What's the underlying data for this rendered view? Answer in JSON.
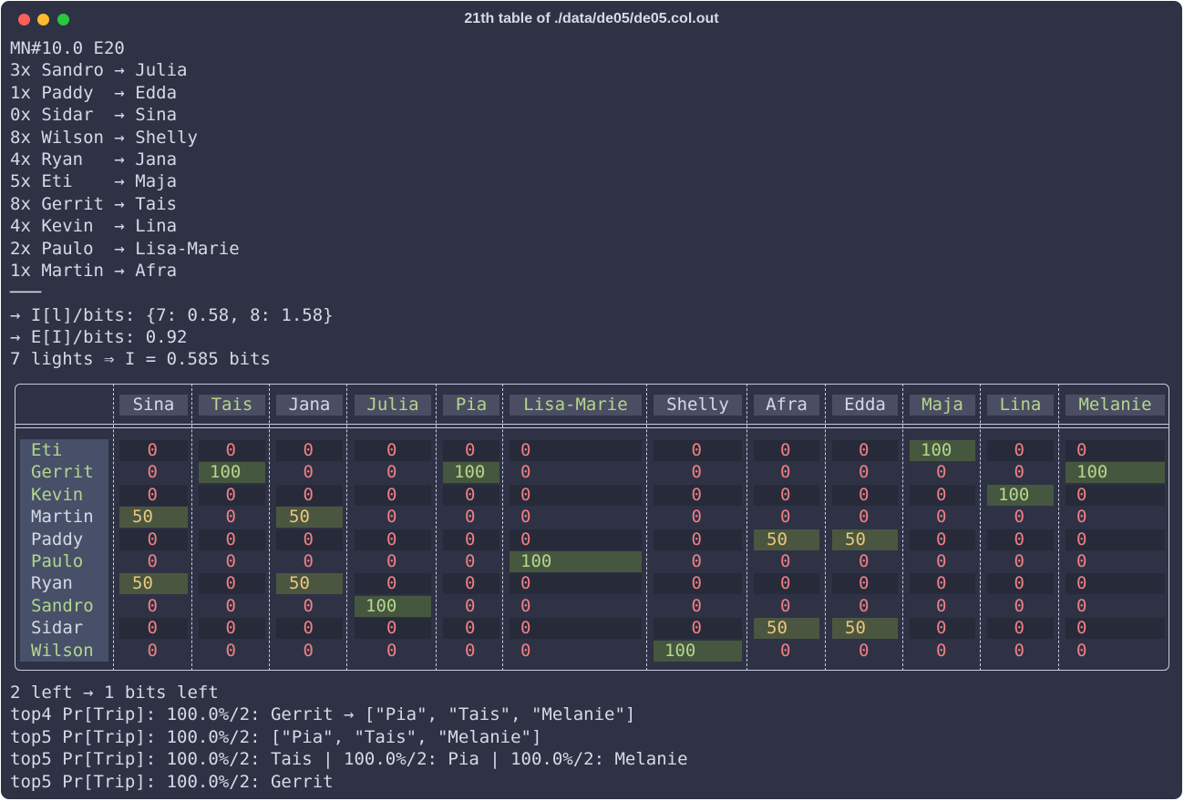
{
  "window": {
    "title": "21th table of ./data/de05/de05.col.out"
  },
  "log_lines": [
    "MN#10.0 E20",
    "3x Sandro → Julia",
    "1x Paddy  → Edda",
    "0x Sidar  → Sina",
    "8x Wilson → Shelly",
    "4x Ryan   → Jana",
    "5x Eti    → Maja",
    "8x Gerrit → Tais",
    "4x Kevin  → Lina",
    "2x Paulo  → Lisa-Marie",
    "1x Martin → Afra",
    "───",
    "→ I[l]/bits: {7: 0.58, 8: 1.58}",
    "→ E[I]/bits: 0.92",
    "7 lights ⇒ I = 0.585 bits"
  ],
  "table": {
    "columns": [
      "Sina",
      "Tais",
      "Jana",
      "Julia",
      "Pia",
      "Lisa-Marie",
      "Shelly",
      "Afra",
      "Edda",
      "Maja",
      "Lina",
      "Melanie"
    ],
    "column_colors": [
      "white",
      "green",
      "white",
      "green",
      "green",
      "green",
      "white",
      "white",
      "white",
      "green",
      "green",
      "green"
    ],
    "rows": [
      {
        "name": "Eti",
        "color": "green",
        "values": [
          "0",
          "0",
          "0",
          "0",
          "0",
          "0",
          "0",
          "0",
          "0",
          "100",
          "0",
          "0"
        ]
      },
      {
        "name": "Gerrit",
        "color": "green",
        "values": [
          "0",
          "100",
          "0",
          "0",
          "100",
          "0",
          "0",
          "0",
          "0",
          "0",
          "0",
          "100"
        ]
      },
      {
        "name": "Kevin",
        "color": "green",
        "values": [
          "0",
          "0",
          "0",
          "0",
          "0",
          "0",
          "0",
          "0",
          "0",
          "0",
          "100",
          "0"
        ]
      },
      {
        "name": "Martin",
        "color": "white",
        "values": [
          "50",
          "0",
          "50",
          "0",
          "0",
          "0",
          "0",
          "0",
          "0",
          "0",
          "0",
          "0"
        ]
      },
      {
        "name": "Paddy",
        "color": "white",
        "values": [
          "0",
          "0",
          "0",
          "0",
          "0",
          "0",
          "0",
          "50",
          "50",
          "0",
          "0",
          "0"
        ]
      },
      {
        "name": "Paulo",
        "color": "green",
        "values": [
          "0",
          "0",
          "0",
          "0",
          "0",
          "100",
          "0",
          "0",
          "0",
          "0",
          "0",
          "0"
        ]
      },
      {
        "name": "Ryan",
        "color": "white",
        "values": [
          "50",
          "0",
          "50",
          "0",
          "0",
          "0",
          "0",
          "0",
          "0",
          "0",
          "0",
          "0"
        ]
      },
      {
        "name": "Sandro",
        "color": "green",
        "values": [
          "0",
          "0",
          "0",
          "100",
          "0",
          "0",
          "0",
          "0",
          "0",
          "0",
          "0",
          "0"
        ]
      },
      {
        "name": "Sidar",
        "color": "white",
        "values": [
          "0",
          "0",
          "0",
          "0",
          "0",
          "0",
          "0",
          "50",
          "50",
          "0",
          "0",
          "0"
        ]
      },
      {
        "name": "Wilson",
        "color": "green",
        "values": [
          "0",
          "0",
          "0",
          "0",
          "0",
          "0",
          "100",
          "0",
          "0",
          "0",
          "0",
          "0"
        ]
      }
    ]
  },
  "footer_lines": [
    "2 left → 1 bits left",
    "top4 Pr[Trip]: 100.0%/2: Gerrit → [\"Pia\", \"Tais\", \"Melanie\"]",
    "top5 Pr[Trip]: 100.0%/2: [\"Pia\", \"Tais\", \"Melanie\"]",
    "top5 Pr[Trip]: 100.0%/2: Tais | 100.0%/2: Pia | 100.0%/2: Melanie",
    "top5 Pr[Trip]: 100.0%/2: Gerrit"
  ],
  "colors": {
    "background": "#2e3244",
    "text": "#d6d9e6",
    "green_text": "#b3d68b",
    "zero_text": "#ef7f86",
    "fifty_text": "#e9c77a",
    "close": "#fe5f57",
    "minimize": "#febc2e",
    "maximize": "#28c840"
  }
}
